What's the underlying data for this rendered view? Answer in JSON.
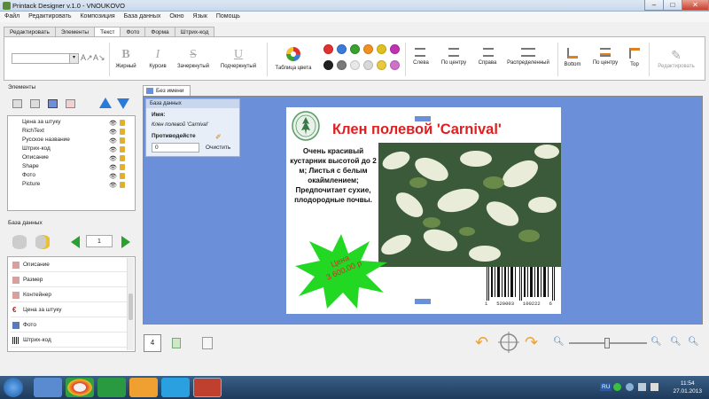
{
  "window": {
    "title": "Printack Designer v.1.0 - VNOUKOVO"
  },
  "menu": [
    "Файл",
    "Редактировать",
    "Композиция",
    "База данных",
    "Окно",
    "Язык",
    "Помощь"
  ],
  "ribbon_tabs": [
    "Редактировать",
    "Элементы",
    "Текст",
    "Фото",
    "Форма",
    "Штрих-код"
  ],
  "ribbon_active_tab": "Текст",
  "ribbon": {
    "bold": "Жирный",
    "italic": "Курсив",
    "strike": "Зачеркнутый",
    "underline": "Подчеркнутый",
    "color_table": "Таблица цвета",
    "align_left": "Слева",
    "align_center": "По центру",
    "align_right": "Справа",
    "align_justify": "Распределенный",
    "valign_bottom": "Bottom",
    "valign_center": "По центру",
    "valign_top": "Top",
    "edit": "Редактировать",
    "swatches": [
      "#e03030",
      "#3a7ad8",
      "#3aa030",
      "#f09020",
      "#e0c020",
      "#c030b0",
      "#202020",
      "#7a7a7a",
      "#e8e8e8",
      "#d8d8d8",
      "#e8c840",
      "#d070c8"
    ]
  },
  "elements_panel": {
    "label": "Элементы",
    "items": [
      "Цена за штуку",
      "RichText",
      "Русское название",
      "Штрих-код",
      "Описание",
      "Shape",
      "Фото",
      "Picture"
    ]
  },
  "database_panel": {
    "label": "База данных",
    "record": "1",
    "items": [
      "Описание",
      "Размер",
      "Контейнер",
      "Цена за штуку",
      "Фото",
      "Штрих-код"
    ]
  },
  "document": {
    "tab": "Без имени",
    "props": {
      "header": "База данных",
      "name_label": "Имя:",
      "name_value": "Клен полевой 'Carnival'",
      "counter_label": "Противодейсте",
      "counter_value": "0",
      "clear": "Очистить"
    },
    "label_card": {
      "title": "Клен полевой 'Carnival'",
      "description": "Очень красивый кустарник высотой до 2 м; Листья с белым окаймлением; Предпочитает сухие, плодородные почвы.",
      "price_line1": "Цена",
      "price_line2": "3 600,00 р",
      "barcode_digits": "1   520003   100222   6"
    }
  },
  "bottom_bar": {
    "page_number": "4"
  },
  "taskbar": {
    "lang": "RU",
    "time": "11:54",
    "date": "27.01.2013"
  }
}
